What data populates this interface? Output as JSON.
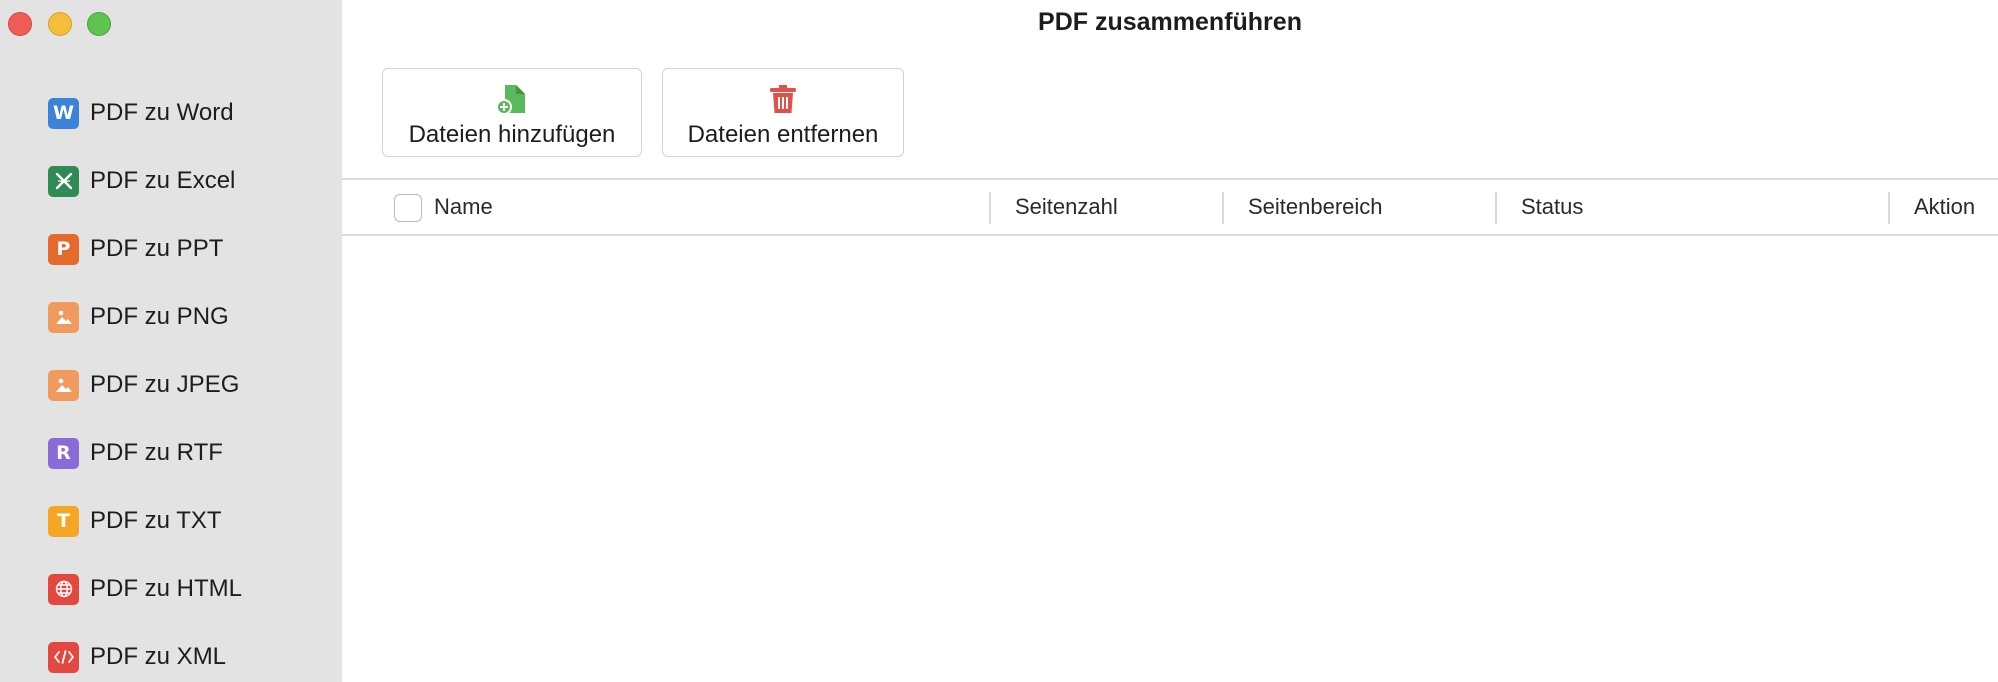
{
  "window": {
    "title": "PDF zusammenführen",
    "controls": {
      "close": "#ee5e56",
      "minimize": "#f4bd3a",
      "zoom": "#5fc350"
    }
  },
  "sidebar": {
    "items": [
      {
        "label": "PDF zu Word",
        "icon": "word-icon",
        "glyph": "W",
        "color": "#3b82d9"
      },
      {
        "label": "PDF zu Excel",
        "icon": "excel-icon",
        "glyph": "✕",
        "color": "#2f8a55"
      },
      {
        "label": "PDF zu PPT",
        "icon": "ppt-icon",
        "glyph": "P",
        "color": "#e66a2c"
      },
      {
        "label": "PDF zu PNG",
        "icon": "image-icon",
        "glyph": "",
        "color": "#f09a5e"
      },
      {
        "label": "PDF zu JPEG",
        "icon": "image-icon",
        "glyph": "",
        "color": "#f09a5e"
      },
      {
        "label": "PDF zu RTF",
        "icon": "rtf-icon",
        "glyph": "R",
        "color": "#8a6ad6"
      },
      {
        "label": "PDF zu TXT",
        "icon": "txt-icon",
        "glyph": "T",
        "color": "#f5a623"
      },
      {
        "label": "PDF zu HTML",
        "icon": "globe-icon",
        "glyph": "",
        "color": "#e3483f"
      },
      {
        "label": "PDF zu XML",
        "icon": "code-icon",
        "glyph": "</>",
        "color": "#e3483f"
      }
    ]
  },
  "toolbar": {
    "add_label": "Dateien hinzufügen",
    "add_icon": "add-file-icon",
    "add_color": "#5cb85c",
    "remove_label": "Dateien entfernen",
    "remove_icon": "trash-icon",
    "remove_color": "#e0514a"
  },
  "table": {
    "columns": [
      "Name",
      "Seitenzahl",
      "Seitenbereich",
      "Status",
      "Aktion"
    ],
    "select_all_checked": false,
    "rows": []
  }
}
